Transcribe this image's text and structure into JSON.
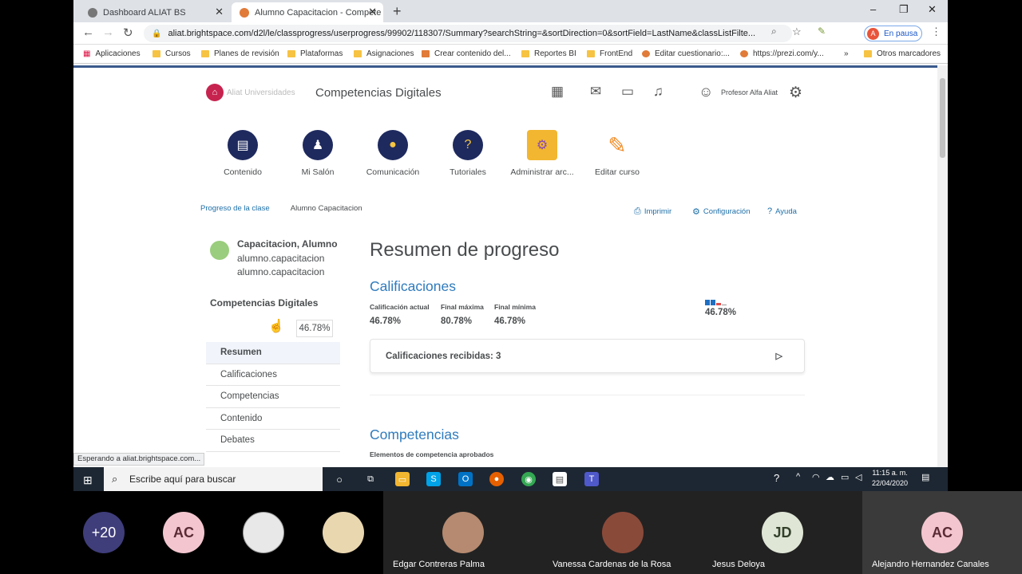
{
  "browser": {
    "tabs": [
      {
        "title": "Dashboard ALIAT BS",
        "active": false
      },
      {
        "title": "Alumno Capacitacion - Compete",
        "active": true
      }
    ],
    "new_tab": "+",
    "window_controls": {
      "minimize": "–",
      "restore": "❐",
      "close": "✕"
    },
    "url": "aliat.brightspace.com/d2l/le/classprogress/userprogress/99902/118307/Summary?searchString=&sortDirection=0&sortField=LastName&classListFilte...",
    "profile_initial": "A",
    "profile_status": "En pausa",
    "bookmarks": [
      "Aplicaciones",
      "Cursos",
      "Planes de revisión",
      "Plataformas",
      "Asignaciones",
      "Crear contenido del...",
      "Reportes BI",
      "FrontEnd",
      "Editar cuestionario:...",
      "https://prezi.com/y...",
      "Otros marcadores"
    ],
    "bookmarks_more": "»",
    "status_text": "Esperando a aliat.brightspace.com..."
  },
  "header": {
    "course_title": "Competencias Digitales",
    "logo_text": "Aliat Universidades",
    "user_name": "Profesor Alfa Aliat"
  },
  "course_nav": [
    {
      "label": "Contenido",
      "icon": "book-icon"
    },
    {
      "label": "Mi Salón",
      "icon": "classroom-icon"
    },
    {
      "label": "Comunicación",
      "icon": "chat-icon"
    },
    {
      "label": "Tutoriales",
      "icon": "question-icon"
    },
    {
      "label": "Administrar arc...",
      "icon": "folder-gear-icon"
    },
    {
      "label": "Editar curso",
      "icon": "wrench-icon"
    }
  ],
  "breadcrumb": {
    "link": "Progreso de la clase",
    "current": "Alumno Capacitacion"
  },
  "actions": {
    "print": "Imprimir",
    "settings": "Configuración",
    "help": "Ayuda"
  },
  "student": {
    "name": "Capacitacion, Alumno",
    "user1": "alumno.capacitacion",
    "user2": "alumno.capacitacion"
  },
  "sidebar": {
    "course": "Competencias Digitales",
    "percent": "46.78%",
    "menu": [
      "Resumen",
      "Calificaciones",
      "Competencias",
      "Contenido",
      "Debates"
    ]
  },
  "main": {
    "title": "Resumen de progreso",
    "grades_heading": "Calificaciones",
    "stats": [
      {
        "label": "Calificación actual",
        "value": "46.78%"
      },
      {
        "label": "Final máxima",
        "value": "80.78%"
      },
      {
        "label": "Final mínima",
        "value": "46.78%"
      }
    ],
    "mini_percent": "46.78%",
    "received": "Calificaciones recibidas: 3",
    "comp_heading": "Competencias",
    "comp_sub": "Elementos de competencia aprobados"
  },
  "taskbar": {
    "search_placeholder": "Escribe aquí para buscar",
    "time": "11:15 a. m.",
    "date": "22/04/2020"
  },
  "participants": [
    {
      "label": "+20",
      "name": "",
      "bg": "#3f3d7a",
      "fg": "#ffffff"
    },
    {
      "label": "AC",
      "name": "",
      "bg": "#f3c6cf",
      "fg": "#5a2b35"
    },
    {
      "label": "",
      "name": "",
      "bg": "#e8e8e8",
      "fg": "#333333"
    },
    {
      "label": "",
      "name": "",
      "bg": "#e9d7b0",
      "fg": "#333333"
    },
    {
      "label": "",
      "name": "Edgar Contreras Palma",
      "bg": "#b58a70",
      "fg": "#ffffff"
    },
    {
      "label": "",
      "name": "Vanessa Cardenas de la Rosa",
      "bg": "#8a4a3a",
      "fg": "#ffffff"
    },
    {
      "label": "JD",
      "name": "Jesus Deloya",
      "bg": "#dfe6d6",
      "fg": "#33402a"
    },
    {
      "label": "AC",
      "name": "Alejandro Hernandez Canales",
      "bg": "#f3c6cf",
      "fg": "#5a2b35"
    }
  ]
}
